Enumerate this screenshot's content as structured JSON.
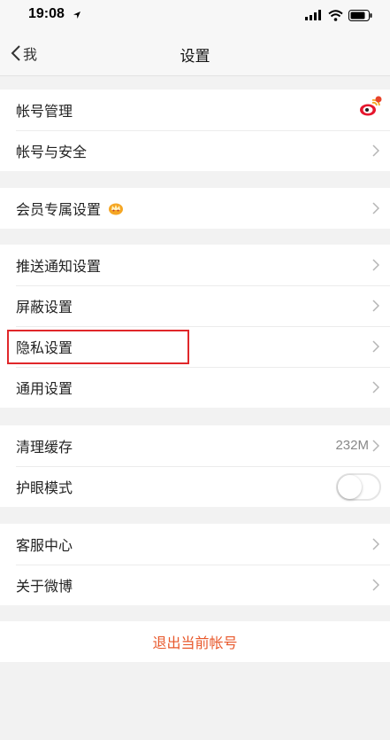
{
  "status_bar": {
    "time": "19:08"
  },
  "nav": {
    "back_label": "我",
    "title": "设置"
  },
  "groups": {
    "account": {
      "manage_label": "帐号管理",
      "security_label": "帐号与安全"
    },
    "member": {
      "label": "会员专属设置"
    },
    "settings": {
      "push_label": "推送通知设置",
      "block_label": "屏蔽设置",
      "privacy_label": "隐私设置",
      "general_label": "通用设置"
    },
    "storage": {
      "cache_label": "清理缓存",
      "cache_size": "232M",
      "eye_label": "护眼模式",
      "eye_mode_on": false
    },
    "about": {
      "service_label": "客服中心",
      "about_label": "关于微博"
    }
  },
  "logout_label": "退出当前帐号",
  "colors": {
    "accent": "#e8582b",
    "highlight": "#e0272a"
  }
}
